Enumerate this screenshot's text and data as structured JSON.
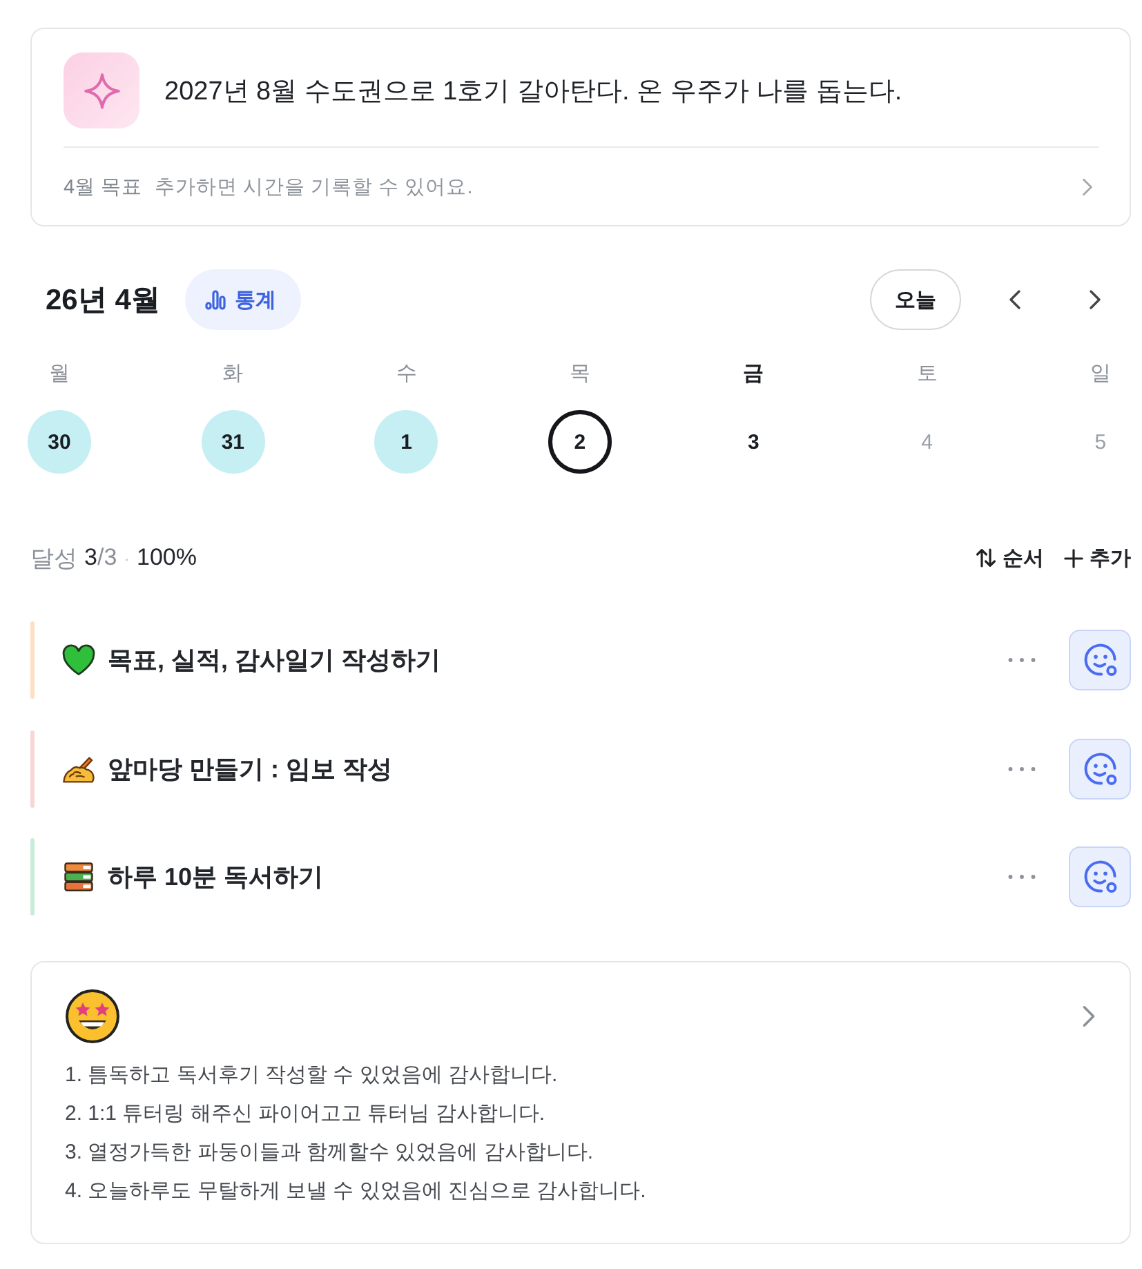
{
  "goal_card": {
    "goal": "2027년 8월 수도권으로 1호기 갈아탄다. 온 우주가 나를 돕는다.",
    "month_goal_label": "4월 목표",
    "hint": "추가하면 시간을 기록할 수 있어요."
  },
  "calendar": {
    "title": "26년 4월",
    "stats_button": "통계",
    "today_button": "오늘",
    "days": [
      {
        "weekday": "월",
        "date": "30",
        "done": true,
        "today": false,
        "selected": false,
        "muted": false
      },
      {
        "weekday": "화",
        "date": "31",
        "done": true,
        "today": false,
        "selected": false,
        "muted": false
      },
      {
        "weekday": "수",
        "date": "1",
        "done": true,
        "today": false,
        "selected": false,
        "muted": false
      },
      {
        "weekday": "목",
        "date": "2",
        "done": false,
        "today": true,
        "selected": false,
        "muted": false
      },
      {
        "weekday": "금",
        "date": "3",
        "done": false,
        "today": false,
        "selected": true,
        "muted": false
      },
      {
        "weekday": "토",
        "date": "4",
        "done": false,
        "today": false,
        "selected": false,
        "muted": true
      },
      {
        "weekday": "일",
        "date": "5",
        "done": false,
        "today": false,
        "selected": false,
        "muted": true
      }
    ]
  },
  "summary": {
    "label": "달성",
    "done": "3",
    "total": "/3",
    "separator": "·",
    "percent": "100%",
    "sort_button": "순서",
    "add_button": "추가"
  },
  "tasks": [
    {
      "kind": "heart",
      "title": "목표, 실적, 감사일기 작성하기",
      "color": "#fde0c4"
    },
    {
      "kind": "writing",
      "title": "앞마당 만들기 : 임보 작성",
      "color": "#f9d6d6"
    },
    {
      "kind": "books",
      "title": "하루 10분 독서하기",
      "color": "#c9ecd9"
    }
  ],
  "gratitude": {
    "lines": [
      "1. 틈독하고 독서후기 작성할 수 있었음에 감사합니다.",
      "2. 1:1 튜터링 해주신 파이어고고 튜터님 감사합니다.",
      "3. 열정가득한 파둥이들과 함께할수 있었음에 감사합니다.",
      "4. 오늘하루도 무탈하게 보낼 수 있었음에 진심으로 감사합니다."
    ]
  }
}
